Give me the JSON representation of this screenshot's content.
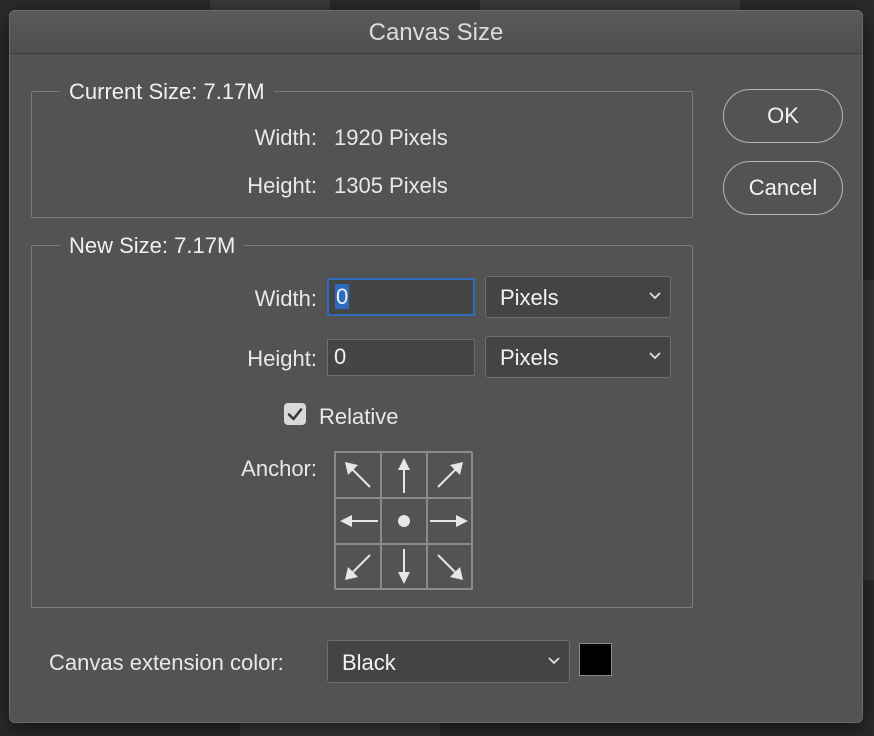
{
  "dialog": {
    "title": "Canvas Size",
    "ok_label": "OK",
    "cancel_label": "Cancel"
  },
  "current_size": {
    "legend": "Current Size: 7.17M",
    "width_label": "Width:",
    "width_value": "1920 Pixels",
    "height_label": "Height:",
    "height_value": "1305 Pixels"
  },
  "new_size": {
    "legend": "New Size: 7.17M",
    "width_label": "Width:",
    "width_value": "0",
    "width_unit": "Pixels",
    "height_label": "Height:",
    "height_value": "0",
    "height_unit": "Pixels",
    "relative_label": "Relative",
    "relative_checked": true,
    "anchor_label": "Anchor:",
    "anchor_cells": [
      "arrow-up-left-icon",
      "arrow-up-icon",
      "arrow-up-right-icon",
      "arrow-left-icon",
      "anchor-center-dot-icon",
      "arrow-right-icon",
      "arrow-down-left-icon",
      "arrow-down-icon",
      "arrow-down-right-icon"
    ]
  },
  "extension": {
    "label": "Canvas extension color:",
    "value": "Black",
    "swatch_color": "#000000"
  },
  "colors": {
    "dialog_bg": "#535353",
    "focus_blue": "#2f6bbd"
  }
}
